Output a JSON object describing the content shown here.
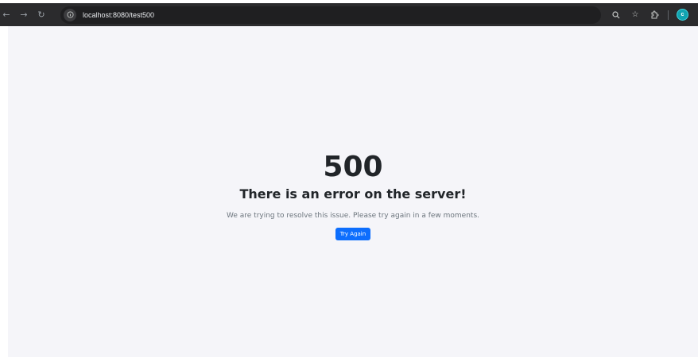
{
  "browser": {
    "back_icon": "arrow-left-icon",
    "forward_icon": "arrow-right-icon",
    "reload_icon": "reload-icon",
    "url": "localhost:8080/test500",
    "avatar_letter": "c",
    "colors": {
      "toolbar": "#2b2b2d",
      "avatar": "#11a4b0"
    }
  },
  "error": {
    "code": "500",
    "title": "There is an error on the server!",
    "description": "We are trying to resolve this issue. Please try again in a few moments.",
    "button_label": "Try Again",
    "button_color": "#0d6efd",
    "background": "#f5f5f9"
  }
}
